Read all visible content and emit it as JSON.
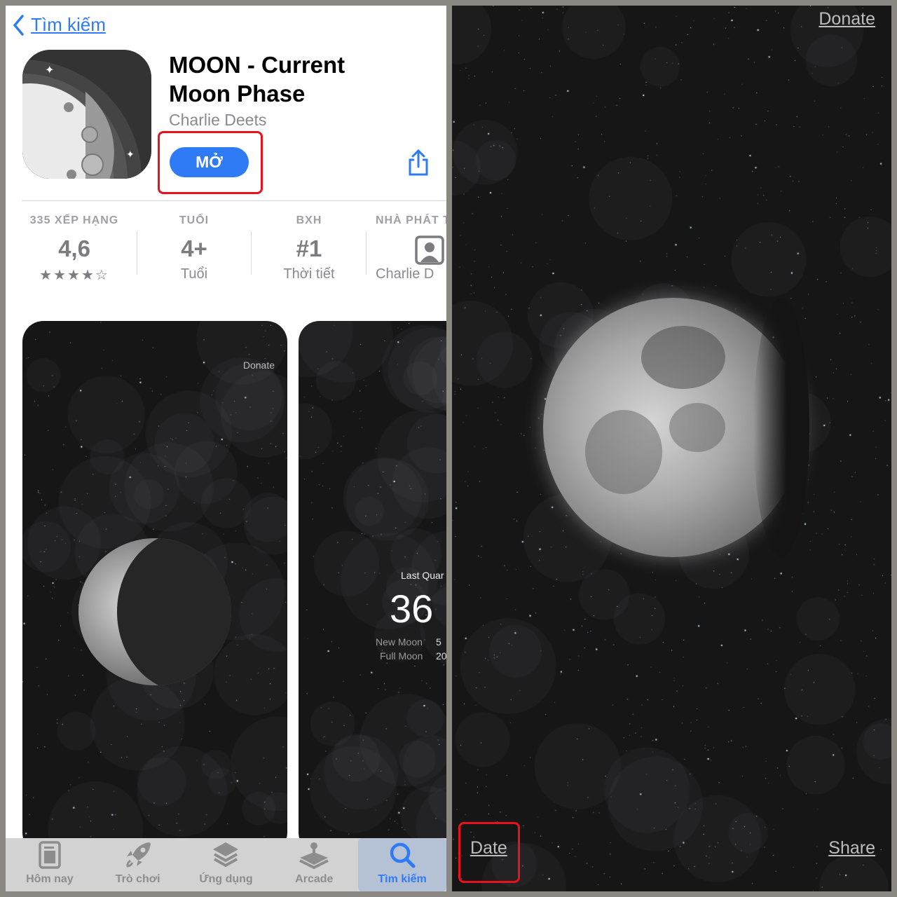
{
  "nav": {
    "back_label": "Tìm kiếm"
  },
  "app": {
    "title": "MOON - Current Moon Phase",
    "developer": "Charlie Deets",
    "open_label": "MỞ"
  },
  "stats": [
    {
      "header": "335 XẾP HẠNG",
      "value": "4,6",
      "sub": "★★★★☆",
      "rating": 4.6
    },
    {
      "header": "TUỔI",
      "value": "4+",
      "sub": "Tuổi"
    },
    {
      "header": "BXH",
      "value": "#1",
      "sub": "Thời tiết"
    },
    {
      "header": "NHÀ PHÁT TRIỂN",
      "value": "",
      "sub": "Charlie D"
    }
  ],
  "screenshot1": {
    "donate": "Donate"
  },
  "screenshot2": {
    "phase": "Last Quar",
    "percent": "36",
    "new_moon_label": "New Moon",
    "new_moon_value": "5",
    "full_moon_label": "Full Moon",
    "full_moon_value": "20"
  },
  "tabs": [
    {
      "label": "Hôm nay",
      "icon": "today-icon"
    },
    {
      "label": "Trò chơi",
      "icon": "rocket-icon"
    },
    {
      "label": "Ứng dụng",
      "icon": "layers-icon"
    },
    {
      "label": "Arcade",
      "icon": "joystick-icon"
    },
    {
      "label": "Tìm kiếm",
      "icon": "search-icon",
      "active": true
    }
  ],
  "right": {
    "donate": "Donate",
    "date": "Date",
    "share": "Share"
  },
  "colors": {
    "accent": "#2f7bf6",
    "highlight": "#e8121d"
  }
}
